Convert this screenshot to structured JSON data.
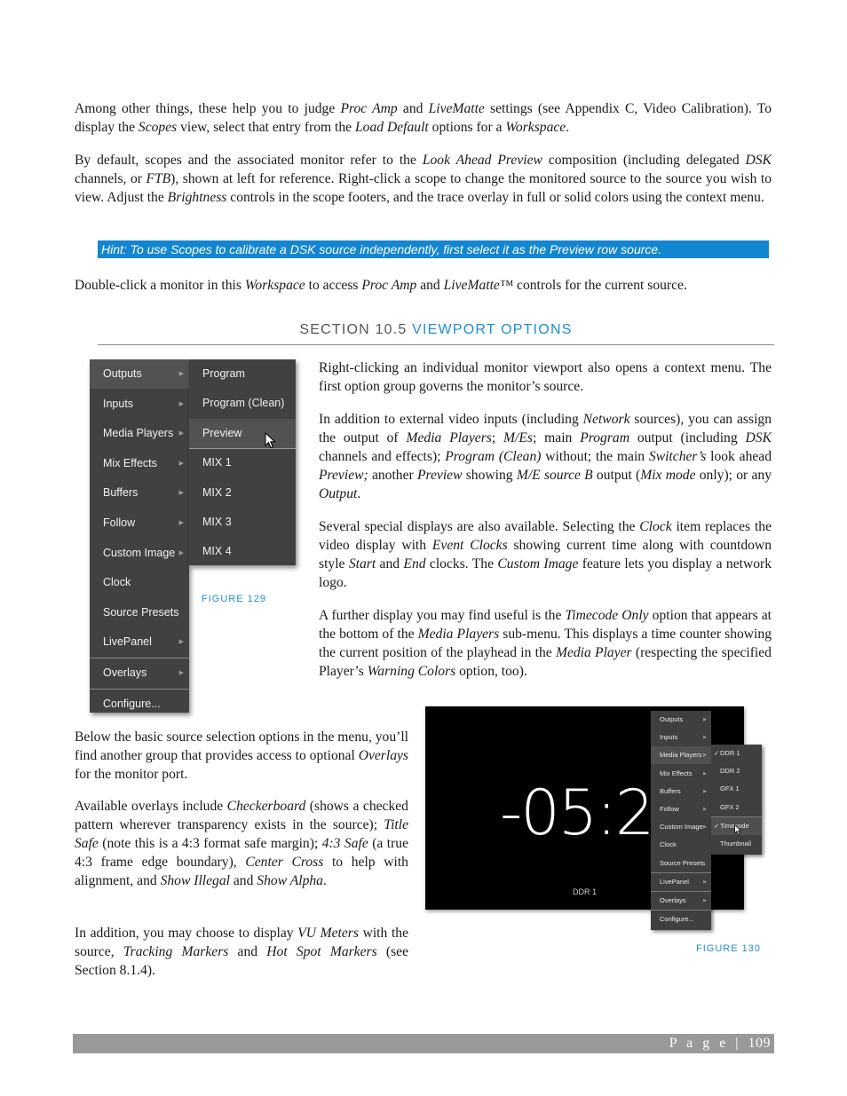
{
  "paragraphs": {
    "p1": [
      {
        "t": "Among other things, these help you to judge "
      },
      {
        "t": "Proc Amp",
        "i": true
      },
      {
        "t": " and "
      },
      {
        "t": "LiveMatte",
        "i": true
      },
      {
        "t": " settings (see Appendix C, Video Calibration).  To display the "
      },
      {
        "t": "Scopes",
        "i": true
      },
      {
        "t": " view, select that entry from the "
      },
      {
        "t": "Load Default",
        "i": true
      },
      {
        "t": " options for a "
      },
      {
        "t": "Workspace",
        "i": true
      },
      {
        "t": "."
      }
    ],
    "p2": [
      {
        "t": "By default, scopes and the associated monitor refer to the "
      },
      {
        "t": "Look Ahead Preview",
        "i": true
      },
      {
        "t": " composition (including delegated "
      },
      {
        "t": "DSK",
        "i": true
      },
      {
        "t": " channels, or "
      },
      {
        "t": "FTB",
        "i": true
      },
      {
        "t": "), shown at left for reference.  Right-click a scope to change the monitored source to the source you wish to view.  Adjust the "
      },
      {
        "t": "Brightness",
        "i": true
      },
      {
        "t": " controls in the scope footers, and the trace overlay in full or solid colors using the context menu."
      }
    ],
    "p3": [
      {
        "t": "Double-click a monitor in this "
      },
      {
        "t": "Workspace",
        "i": true
      },
      {
        "t": " to access "
      },
      {
        "t": "Proc Amp",
        "i": true
      },
      {
        "t": " and "
      },
      {
        "t": "LiveMatte™",
        "i": true
      },
      {
        "t": " controls for the current source."
      }
    ],
    "p4": [
      {
        "t": "Right-clicking an individual monitor viewport also opens a context menu.  The first option group governs the monitor’s source."
      }
    ],
    "p5": [
      {
        "t": "In addition to external video inputs (including "
      },
      {
        "t": "Network",
        "i": true
      },
      {
        "t": " sources), you can assign the output of "
      },
      {
        "t": "Media Players",
        "i": true
      },
      {
        "t": "; "
      },
      {
        "t": "M/Es",
        "i": true
      },
      {
        "t": "; main "
      },
      {
        "t": "Program",
        "i": true
      },
      {
        "t": " output (including "
      },
      {
        "t": "DSK",
        "i": true
      },
      {
        "t": " channels and effects); "
      },
      {
        "t": "Program (Clean)",
        "i": true
      },
      {
        "t": " without; the main "
      },
      {
        "t": "Switcher’s",
        "i": true
      },
      {
        "t": " look ahead "
      },
      {
        "t": "Preview;",
        "i": true
      },
      {
        "t": " another "
      },
      {
        "t": "Preview",
        "i": true
      },
      {
        "t": " showing "
      },
      {
        "t": "M/E source B",
        "i": true
      },
      {
        "t": " output ("
      },
      {
        "t": "Mix mode",
        "i": true
      },
      {
        "t": " only); or any "
      },
      {
        "t": "Output",
        "i": true
      },
      {
        "t": "."
      }
    ],
    "p6": [
      {
        "t": "Several special displays are also available. Selecting the "
      },
      {
        "t": "Clock",
        "i": true
      },
      {
        "t": " item replaces the video display with "
      },
      {
        "t": "Event Clocks",
        "i": true
      },
      {
        "t": " showing current time along with countdown style "
      },
      {
        "t": "Start",
        "i": true
      },
      {
        "t": " and "
      },
      {
        "t": "End",
        "i": true
      },
      {
        "t": " clocks.  The "
      },
      {
        "t": "Custom Image",
        "i": true
      },
      {
        "t": " feature lets you display a network logo."
      }
    ],
    "p7": [
      {
        "t": "A further display you may find useful is the "
      },
      {
        "t": "Timecode Only",
        "i": true
      },
      {
        "t": " option that appears at the bottom of the "
      },
      {
        "t": "Media Players",
        "i": true
      },
      {
        "t": " sub-menu.  This displays a time counter showing the current position of the playhead in the "
      },
      {
        "t": "Media Player",
        "i": true
      },
      {
        "t": " (respecting the specified Player’s "
      },
      {
        "t": "Warning Colors",
        "i": true
      },
      {
        "t": " option, too)."
      }
    ],
    "p8": [
      {
        "t": "Below the basic source selection options in the menu, you’ll find another group that provides access to optional "
      },
      {
        "t": "Overlays",
        "i": true
      },
      {
        "t": " for the monitor port."
      }
    ],
    "p9": [
      {
        "t": "Available overlays include "
      },
      {
        "t": "Checkerboard",
        "i": true
      },
      {
        "t": " (shows a checked pattern wherever transparency exists in the source); "
      },
      {
        "t": "Title Safe",
        "i": true
      },
      {
        "t": " (note this is a 4:3 format safe margin); "
      },
      {
        "t": "4:3 Safe",
        "i": true
      },
      {
        "t": " (a true 4:3 frame edge boundary), "
      },
      {
        "t": "Center Cross",
        "i": true
      },
      {
        "t": " to help with alignment, and "
      },
      {
        "t": "Show Illegal",
        "i": true
      },
      {
        "t": " and "
      },
      {
        "t": "Show Alpha",
        "i": true
      },
      {
        "t": "."
      }
    ],
    "p10": [
      {
        "t": "In addition, you may choose to display "
      },
      {
        "t": "VU Meters",
        "i": true
      },
      {
        "t": " with the source, "
      },
      {
        "t": "Tracking Markers",
        "i": true
      },
      {
        "t": " and "
      },
      {
        "t": "Hot Spot Markers",
        "i": true
      },
      {
        "t": " (see Section 8.1.4)."
      }
    ]
  },
  "hint": "Hint: To use Scopes to calibrate a DSK source independently, first select it as the Preview row source.",
  "section": {
    "prefix": "SECTION 10.5 ",
    "title": "VIEWPORT OPTIONS"
  },
  "figure129": {
    "caption": "FIGURE 129",
    "main_menu": [
      {
        "label": "Outputs",
        "submenu": true,
        "highlighted": true
      },
      {
        "label": "Inputs",
        "submenu": true
      },
      {
        "label": "Media Players",
        "submenu": true
      },
      {
        "label": "Mix Effects",
        "submenu": true
      },
      {
        "label": "Buffers",
        "submenu": true
      },
      {
        "label": "Follow",
        "submenu": true
      },
      {
        "label": "Custom Image",
        "submenu": true
      },
      {
        "label": "Clock",
        "submenu": false
      },
      {
        "label": "Source Presets",
        "submenu": false
      },
      {
        "label": "LivePanel",
        "submenu": true
      },
      {
        "label": "Overlays",
        "submenu": true
      },
      {
        "label": "Configure...",
        "submenu": false
      }
    ],
    "sub_menu": [
      {
        "label": "Program"
      },
      {
        "label": "Program (Clean)"
      },
      {
        "label": "Preview",
        "highlighted": true
      },
      {
        "label": "MIX 1"
      },
      {
        "label": "MIX 2"
      },
      {
        "label": "MIX 3"
      },
      {
        "label": "MIX 4"
      }
    ]
  },
  "figure130": {
    "caption": "FIGURE 130",
    "clock_display": "-05:2",
    "monitor_label": "DDR 1",
    "main_menu": [
      {
        "label": "Outputs",
        "submenu": true
      },
      {
        "label": "Inputs",
        "submenu": true
      },
      {
        "label": "Media Players",
        "submenu": true,
        "highlighted": true
      },
      {
        "label": "Mix Effects",
        "submenu": true
      },
      {
        "label": "Buffers",
        "submenu": true
      },
      {
        "label": "Follow",
        "submenu": true
      },
      {
        "label": "Custom Image",
        "submenu": true
      },
      {
        "label": "Clock",
        "submenu": false
      },
      {
        "label": "Source Presets",
        "submenu": false
      },
      {
        "label": "LivePanel",
        "submenu": true
      },
      {
        "label": "Overlays",
        "submenu": true
      },
      {
        "label": "Configure...",
        "submenu": false
      }
    ],
    "sub_menu": [
      {
        "label": "DDR 1",
        "checked": true
      },
      {
        "label": "DDR 2"
      },
      {
        "label": "GFX 1"
      },
      {
        "label": "GFX 2"
      },
      {
        "label": "Timecode",
        "checked": true,
        "highlighted": true
      },
      {
        "label": "Thumbnail"
      }
    ]
  },
  "footer": {
    "page_label": "P a g e",
    "separator": " | ",
    "page_number": "109"
  },
  "colors": {
    "accent": "#1e8ed1",
    "hint_bg": "#1386d1",
    "menu_bg": "#414141",
    "footer_bg": "#999999"
  }
}
